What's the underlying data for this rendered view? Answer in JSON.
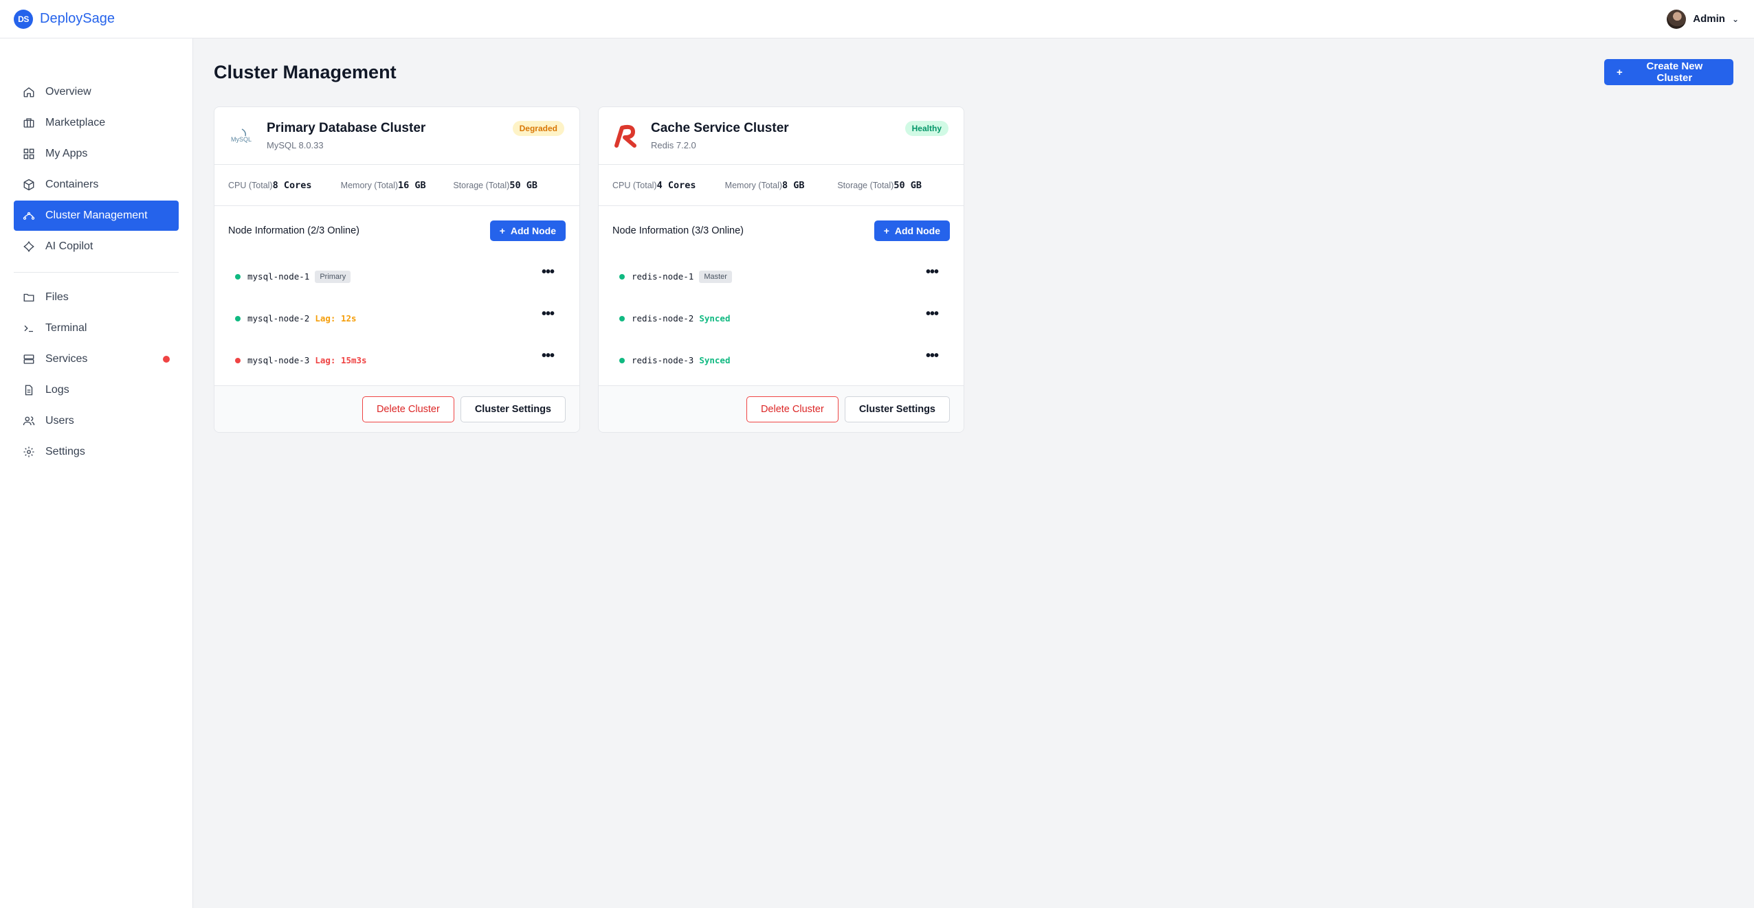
{
  "app": {
    "logo_text": "DS",
    "name": "DeploySage",
    "user_name": "Admin",
    "brand_color": "#2563eb"
  },
  "sidebar": {
    "items": [
      {
        "label": "Overview",
        "icon": "home-icon"
      },
      {
        "label": "Marketplace",
        "icon": "briefcase-icon"
      },
      {
        "label": "My Apps",
        "icon": "grid-icon"
      },
      {
        "label": "Containers",
        "icon": "box-icon"
      },
      {
        "label": "Cluster Management",
        "icon": "cluster-icon",
        "active": true
      },
      {
        "label": "AI Copilot",
        "icon": "copilot-icon"
      },
      {
        "label": "Files",
        "icon": "folder-icon"
      },
      {
        "label": "Terminal",
        "icon": "terminal-icon"
      },
      {
        "label": "Services",
        "icon": "server-icon",
        "alert": true
      },
      {
        "label": "Logs",
        "icon": "file-text-icon"
      },
      {
        "label": "Users",
        "icon": "users-icon"
      },
      {
        "label": "Settings",
        "icon": "gear-icon"
      }
    ]
  },
  "main": {
    "title": "Cluster Management",
    "create_button": "Create New Cluster"
  },
  "clusters": [
    {
      "name": "Primary Database Cluster",
      "version": "MySQL 8.0.33",
      "logo": "mysql-logo",
      "logo_text": "MySQL",
      "status": "Degraded",
      "stats": [
        {
          "label": "CPU (Total)",
          "value": "8 Cores"
        },
        {
          "label": "Memory (Total)",
          "value": "16 GB"
        },
        {
          "label": "Storage (Total)",
          "value": "50 GB"
        }
      ],
      "nodes_title": "Node Information (2/3 Online)",
      "add_node": "Add Node",
      "nodes": [
        {
          "name": "mysql-node-1",
          "tag": "Primary",
          "status": "",
          "dot": "#10b981",
          "status_color": "#111827"
        },
        {
          "name": "mysql-node-2",
          "tag": "",
          "status": "Lag: 12s",
          "dot": "#10b981",
          "status_color": "#f59e0b"
        },
        {
          "name": "mysql-node-3",
          "tag": "",
          "status": "Lag: 15m3s",
          "dot": "#ef4444",
          "status_color": "#ef4444"
        }
      ],
      "delete_label": "Delete Cluster",
      "settings_label": "Cluster Settings"
    },
    {
      "name": "Cache Service Cluster",
      "version": "Redis 7.2.0",
      "logo": "redis-logo",
      "status": "Healthy",
      "stats": [
        {
          "label": "CPU (Total)",
          "value": "4 Cores"
        },
        {
          "label": "Memory (Total)",
          "value": "8 GB"
        },
        {
          "label": "Storage (Total)",
          "value": "50 GB"
        }
      ],
      "nodes_title": "Node Information (3/3 Online)",
      "add_node": "Add Node",
      "nodes": [
        {
          "name": "redis-node-1",
          "tag": "Master",
          "status": "",
          "dot": "#10b981",
          "status_color": "#111827"
        },
        {
          "name": "redis-node-2",
          "tag": "",
          "status": "Synced",
          "dot": "#10b981",
          "status_color": "#10b981"
        },
        {
          "name": "redis-node-3",
          "tag": "",
          "status": "Synced",
          "dot": "#10b981",
          "status_color": "#10b981"
        }
      ],
      "delete_label": "Delete Cluster",
      "settings_label": "Cluster Settings"
    }
  ]
}
